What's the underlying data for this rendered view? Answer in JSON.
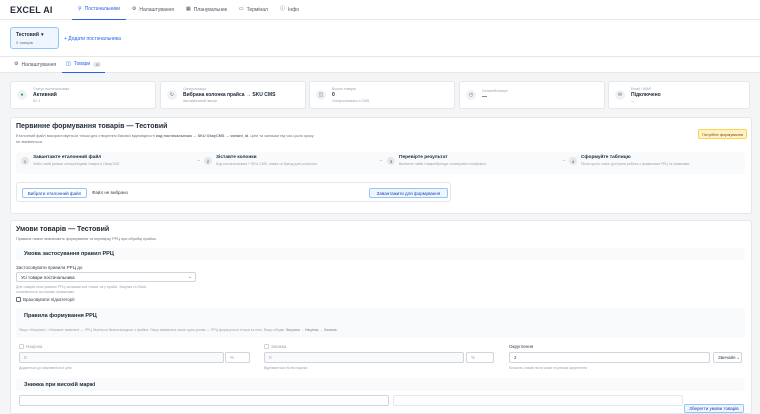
{
  "app": {
    "logo": "EXCEL AI"
  },
  "nav": [
    {
      "label": "Постачальники",
      "icon": "person-icon",
      "glyph": "⚲"
    },
    {
      "label": "Налаштування",
      "icon": "gear-icon",
      "glyph": "⚙"
    },
    {
      "label": "Планувальник",
      "icon": "calendar-icon",
      "glyph": "▦"
    },
    {
      "label": "Термінал",
      "icon": "terminal-icon",
      "glyph": "▭"
    },
    {
      "label": "Інфо",
      "icon": "info-icon",
      "glyph": "ⓘ"
    }
  ],
  "suppliers": {
    "card": {
      "name": "Тестовий",
      "sub": "0 товарів",
      "chevron": "▾"
    },
    "add_label": "+ Додати постачальника"
  },
  "subtabs": [
    {
      "label": "Налаштування",
      "icon": "gear-icon",
      "glyph": "⚙"
    },
    {
      "label": "Товари",
      "icon": "box-icon",
      "glyph": "◫",
      "count": "0"
    }
  ],
  "stats": [
    {
      "label": "Статус постачальника",
      "value": "Активний",
      "sub": "ID: 1",
      "icon": "status-icon",
      "glyph": "●",
      "color": "#16a34a"
    },
    {
      "label": "Синхронізація",
      "value": "Вибрана колонка прайса → SKU CMS",
      "sub": "Автоматичний імпорт",
      "icon": "sync-icon",
      "glyph": "↻",
      "color": "#6b7280"
    },
    {
      "label": "Всього товарів",
      "value": "0",
      "sub": "Синхронізовано з CMS",
      "icon": "box-icon",
      "glyph": "◫",
      "color": "#6b7280"
    },
    {
      "label": "Останній імпорт",
      "value": "—",
      "sub": "",
      "icon": "clock-icon",
      "glyph": "◷",
      "color": "#6b7280"
    },
    {
      "label": "Email / IMAP",
      "value": "Підключено",
      "sub": "—",
      "icon": "mail-icon",
      "glyph": "✉",
      "color": "#6b7280"
    }
  ],
  "first_panel": {
    "title": "Первинне формування товарів — Тестовий",
    "desc_1": "Еталонний файл використовується тільки для створення базової відповідності",
    "desc_bold": "код постачальника → SKU OkayCMS → variant_id",
    "desc_2": ". Ціни та залишки під час цього кроку",
    "desc_3": "не змінюються.",
    "badge": "Потрібне формування",
    "steps": [
      {
        "num": "1",
        "title": "Завантажте еталонний файл",
        "desc": "Файл, який раніше синхронізував товари в OkayCMS."
      },
      {
        "num": "2",
        "title": "Зіставте колонки",
        "desc": "Код постачальника + SKU CMS, назва та бренд для контролю."
      },
      {
        "num": "3",
        "title": "Перевірте результат",
        "desc": "Визначте зайві товари/бренди та виправте конфлікти."
      },
      {
        "num": "4",
        "title": "Сформуйте таблицю",
        "desc": "Після цього стане доступна робота з правилами РРЦ та знижками."
      }
    ],
    "arrow": "→",
    "select_file": "Вибрати еталонний файл",
    "file_status": "Файл не вибрано",
    "upload": "Завантажити для формування"
  },
  "conditions_panel": {
    "title": "Умови товарів — Тестовий",
    "desc": "Правила нижче визначають формування та перевірку РРЦ при обробці прайса.",
    "rrc_section": "Умова застосування правил РРЦ",
    "apply_label": "Застосовувати правила РРЦ до",
    "apply_value": "Усі товари постачальника",
    "apply_hint_1": "Для товарів поза умовою РРЦ залишається тільки, як у прайсі, Закупка та Stock",
    "apply_hint_2": "оновлюються за іншими правилами.",
    "subcat_label": "Враховувати підкатегорії",
    "rules_section": "Правила формування РРЦ",
    "rules_hint_1": "Якщо «Націнка» і «Знижка» вимкнені — РРЦ береться безпосередньо з прайса. Якщо ввімкнена лише одна умова — РРЦ формується тільки за нею. Якщо обидві:",
    "rules_hint_b": "Закупка → Націнка → Знижка",
    "rules_hint_2": ".",
    "markup_label": "Націнка",
    "markup_value": "0",
    "markup_unit": "%",
    "markup_hint": "Додається до закупівельної ціни",
    "discount_label": "Знижка",
    "discount_value": "0",
    "discount_unit": "%",
    "discount_hint": "Віднімається після націнки",
    "round_label": "Округлення",
    "round_value": "2",
    "round_mode": "Звичайн",
    "round_hint": "Кількість знаків після коми та режим округлення",
    "high_margin_section": "Знижка при високій маржі",
    "save_button": "Зберегти умови товарів"
  }
}
